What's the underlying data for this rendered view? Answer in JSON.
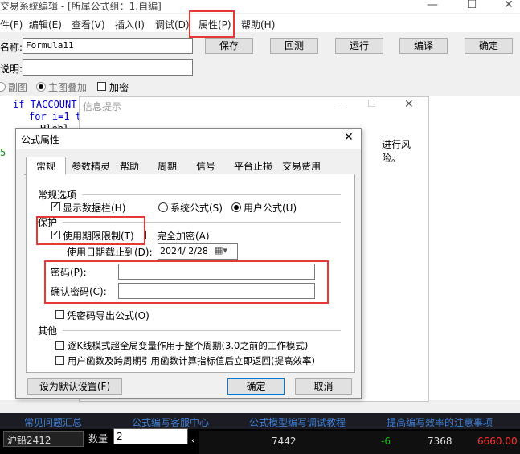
{
  "window": {
    "title": "交易系统编辑 - [所属公式组：1.自编]",
    "controls": [
      "—",
      "☐",
      "✕"
    ]
  },
  "menu": {
    "items": [
      "件(F)",
      "编辑(E)",
      "查看(V)",
      "插入(I)",
      "调试(D)",
      "属性(P)",
      "帮助(H)"
    ],
    "highlighted": "属性(P)"
  },
  "toolbar": {
    "name_label": "名称:",
    "name_value": "Formula11",
    "desc_label": "说明:",
    "desc_value": "",
    "save": "保存",
    "replay": "回测",
    "run": "运行",
    "compile": "编译",
    "ok": "确定",
    "option_subchart": "副图",
    "option_mainoverlay": "主图叠加",
    "option_encrypt": "加密"
  },
  "editor": {
    "lines": [
      "if  TACCOUNT",
      "for i=1 t",
      "Hlebl"
    ],
    "gutter_mark": "5"
  },
  "info_window": {
    "title": "信息提示",
    "text_fragment": "进行风险。"
  },
  "dialog": {
    "title": "公式属性",
    "tabs": [
      "常规",
      "参数精灵",
      "帮助",
      "周期",
      "信号",
      "平台止损",
      "交易费用"
    ],
    "active_tab": "常规",
    "general_group": "常规选项",
    "show_databar": "显示数据栏(H)",
    "system_formula": "系统公式(S)",
    "user_formula": "用户公式(U)",
    "protect_group": "保护",
    "use_period_limit": "使用期限限制(T)",
    "full_encrypt": "完全加密(A)",
    "date_label": "使用日期截止到(D):",
    "date_value": "2024/ 2/28",
    "password_label": "密码(P):",
    "password_value": "",
    "confirm_password_label": "确认密码(C):",
    "confirm_password_value": "",
    "export_with_password": "凭密码导出公式(O)",
    "other_group": "其他",
    "opt_stepwise": "逐K线模式超全局变量作用于整个周期(3.0之前的工作模式)",
    "opt_userfunc": "用户函数及跨周期引用函数计算指标值后立即返回(提高效率)",
    "set_default": "设为默认设置(F)",
    "ok": "确定",
    "cancel": "取消",
    "close": "✕"
  },
  "links": [
    "常见问题汇总",
    "公式编写客服中心",
    "公式模型编写调试教程",
    "提高编写效率的注意事项"
  ],
  "quote": {
    "symbol": "沪铅2412",
    "qty_label": "数量",
    "qty_value": "2",
    "price": "7442",
    "change": "-6",
    "vol": "7368",
    "last": "6660.00"
  },
  "colors": {
    "highlight_red": "#e53935",
    "link_blue": "#3b7fd6",
    "up_red": "#ff3030",
    "down_green": "#00c000"
  }
}
